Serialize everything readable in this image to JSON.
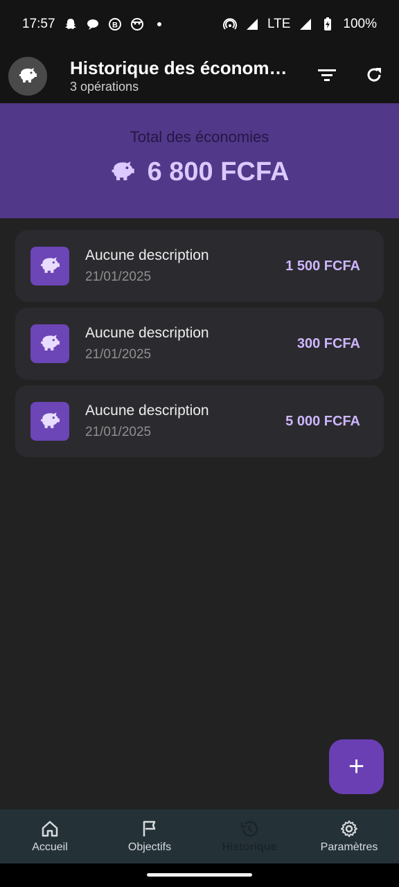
{
  "status": {
    "time": "17:57",
    "network": "LTE",
    "battery": "100%",
    "left_icons": [
      "snapchat-icon",
      "chat-icon",
      "b-badge-icon",
      "face-icon",
      "dot-icon"
    ],
    "right_icons": [
      "hotspot-icon",
      "signal-icon",
      "signal-icon",
      "battery-charging-icon"
    ]
  },
  "app_bar": {
    "title": "Historique des économ…",
    "subtitle": "3 opérations",
    "avatar_icon": "piggy-bank-icon",
    "actions": [
      "filter-icon",
      "refresh-icon"
    ]
  },
  "summary": {
    "label": "Total des économies",
    "total": "6 800 FCFA",
    "icon": "piggy-bank-icon"
  },
  "transactions": [
    {
      "description": "Aucune description",
      "date": "21/01/2025",
      "amount": "1 500 FCFA"
    },
    {
      "description": "Aucune description",
      "date": "21/01/2025",
      "amount": "300 FCFA"
    },
    {
      "description": "Aucune description",
      "date": "21/01/2025",
      "amount": "5 000 FCFA"
    }
  ],
  "fab": {
    "label": "+"
  },
  "nav": {
    "items": [
      {
        "label": "Accueil",
        "icon": "home-icon"
      },
      {
        "label": "Objectifs",
        "icon": "flag-icon"
      },
      {
        "label": "Historique",
        "icon": "history-icon",
        "active": true
      },
      {
        "label": "Paramètres",
        "icon": "gear-icon"
      }
    ]
  },
  "colors": {
    "banner": "#513889",
    "accent": "#cdb6ff",
    "card": "#2b2a2e",
    "fab": "#6a3fb4",
    "nav": "#243238"
  }
}
